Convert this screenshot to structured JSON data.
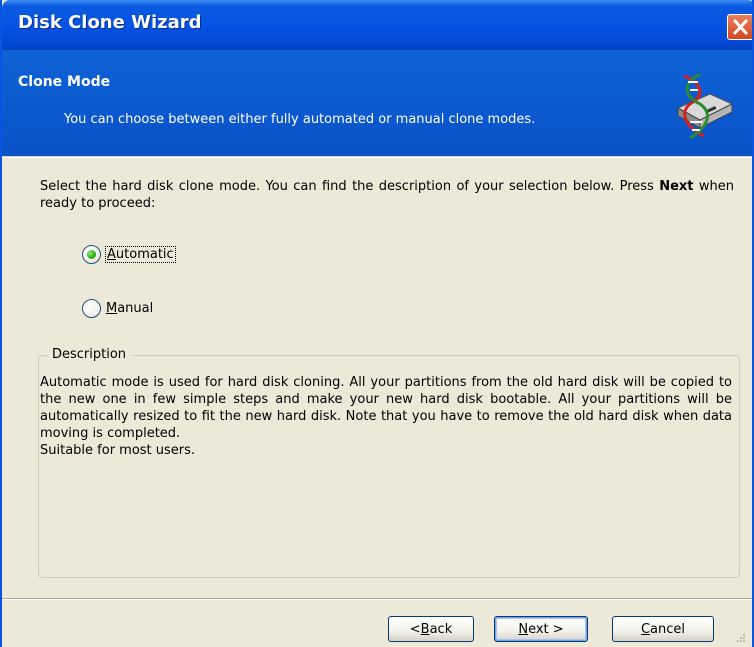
{
  "window": {
    "title": "Disk Clone Wizard"
  },
  "header": {
    "title": "Clone Mode",
    "subtitle": "You can choose between either fully automated or manual clone modes.",
    "icon": "disk-clone-icon"
  },
  "content": {
    "intro_before_bold": "Select the hard disk clone mode. You can find the description of your selection below. Press ",
    "intro_bold": "Next",
    "intro_after_bold": " when ready to proceed:",
    "options": [
      {
        "mnemonic": "A",
        "rest": "utomatic",
        "selected": true
      },
      {
        "mnemonic": "M",
        "rest": "anual",
        "selected": false
      }
    ]
  },
  "description": {
    "legend": "Description",
    "paragraph": "Automatic mode is used for hard disk cloning. All your partitions from the old hard disk will be copied to the new one in few simple steps and make your new hard disk bootable. All your partitions will be automatically resized to fit the new hard disk. Note that you have to remove the old hard disk when data moving is completed.",
    "note": "Suitable for most users."
  },
  "buttons": {
    "back": {
      "pre": "< ",
      "mnemonic": "B",
      "post": "ack"
    },
    "next": {
      "pre": "",
      "mnemonic": "N",
      "post": "ext >"
    },
    "cancel": {
      "pre": "",
      "mnemonic": "C",
      "post": "ancel"
    }
  },
  "colors": {
    "titlebar": "#0554E3",
    "header": "#0B58CF",
    "dialog_bg": "#ECE9D8",
    "radio_selected": "#2EB21A",
    "close_button": "#D1481E"
  }
}
